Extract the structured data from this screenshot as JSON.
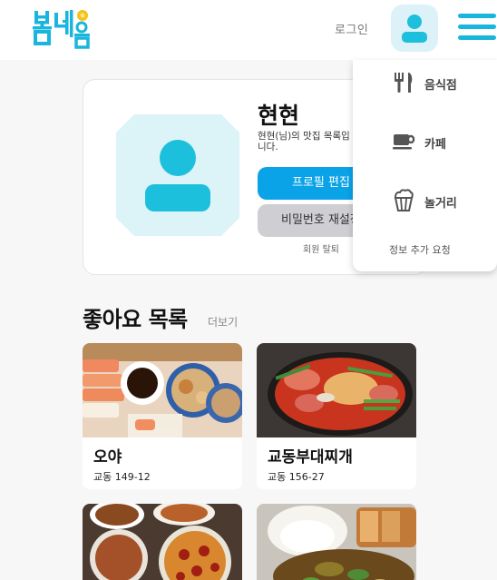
{
  "header": {
    "logo_text": "봄내음",
    "login_label": "로그인"
  },
  "profile": {
    "name": "현현",
    "description": "현현(님)의 맛집 목록입니다.",
    "edit_button": "프로필 편집",
    "password_button": "비밀번호 재설정",
    "withdraw_link": "회원 탈퇴"
  },
  "likes": {
    "title": "좋아요 목록",
    "more_label": "더보기",
    "items": [
      {
        "name": "오야",
        "address": "교동 149-12"
      },
      {
        "name": "교동부대찌개",
        "address": "교동 156-27"
      },
      {
        "name": "",
        "address": ""
      },
      {
        "name": "",
        "address": ""
      }
    ]
  },
  "menu": {
    "items": [
      {
        "label": "음식점",
        "icon": "fork-knife-icon"
      },
      {
        "label": "카페",
        "icon": "coffee-cup-icon"
      },
      {
        "label": "놀거리",
        "icon": "popcorn-icon"
      }
    ],
    "request_label": "정보 추가 요청"
  },
  "colors": {
    "brand_blue": "#0aa3e8",
    "accent_cyan": "#18b6dc",
    "avatar_bg": "#dcf2f8",
    "logo_yellow": "#f3c21b"
  }
}
